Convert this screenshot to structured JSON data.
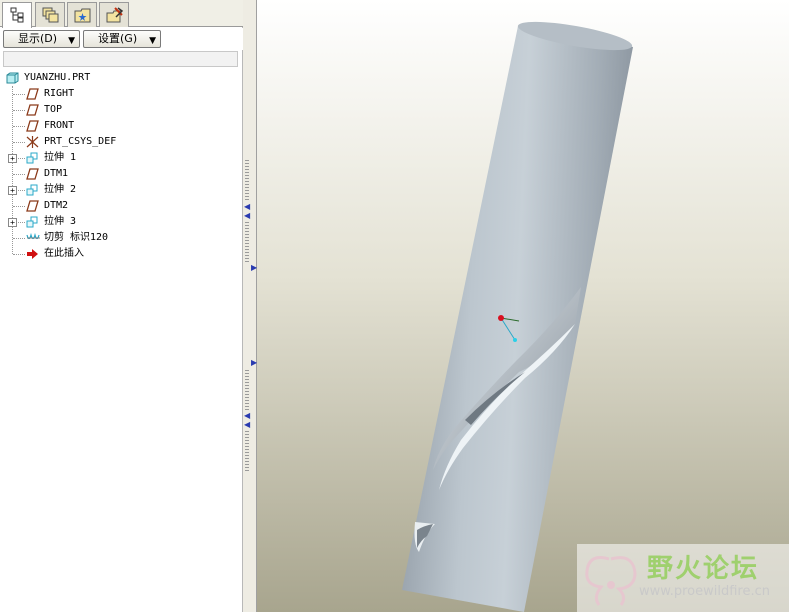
{
  "tabs": [
    {
      "icon": "model-tree-icon",
      "active": true
    },
    {
      "icon": "layers-icon",
      "active": false
    },
    {
      "icon": "folder-browser-icon",
      "active": false
    },
    {
      "icon": "favorites-icon",
      "active": false
    }
  ],
  "toolbar": {
    "show_label": "显示(D)",
    "settings_label": "设置(G)"
  },
  "tree": {
    "root": "YUANZHU.PRT",
    "items": [
      {
        "label": "RIGHT",
        "icon": "datum-plane-icon"
      },
      {
        "label": "TOP",
        "icon": "datum-plane-icon"
      },
      {
        "label": "FRONT",
        "icon": "datum-plane-icon"
      },
      {
        "label": "PRT_CSYS_DEF",
        "icon": "coordinate-system-icon"
      },
      {
        "label": "拉伸 1",
        "icon": "extrude-icon",
        "expandable": true
      },
      {
        "label": "DTM1",
        "icon": "datum-plane-icon"
      },
      {
        "label": "拉伸 2",
        "icon": "extrude-icon",
        "expandable": true
      },
      {
        "label": "DTM2",
        "icon": "datum-plane-icon"
      },
      {
        "label": "拉伸 3",
        "icon": "extrude-icon",
        "expandable": true
      },
      {
        "label": "切剪 标识120",
        "icon": "sweep-cut-icon"
      },
      {
        "label": "在此插入",
        "icon": "insert-here-arrow-icon"
      }
    ]
  },
  "watermark": {
    "title": "野火论坛",
    "url": "www.proewildfire.cn"
  },
  "colors": {
    "datum_plane": "#8b3a1a",
    "feature_icon": "#2aa8c8",
    "insert_arrow": "#d01010",
    "cylinder": "#a9b3bc",
    "watermark_green": "#9fd06e"
  }
}
